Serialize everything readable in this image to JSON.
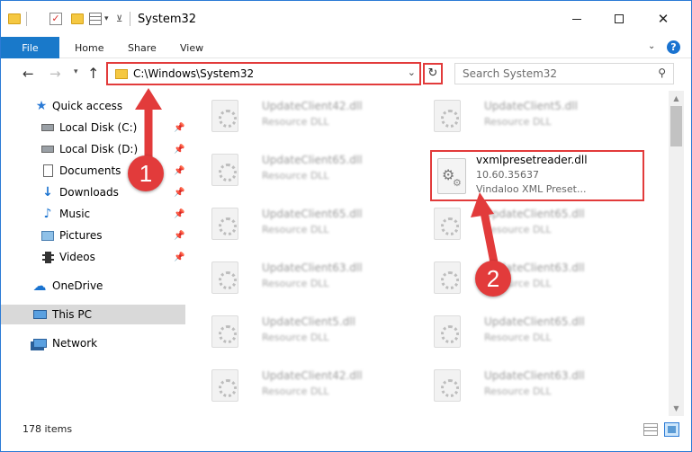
{
  "window": {
    "title": "System32"
  },
  "ribbon": {
    "file": "File",
    "tabs": [
      "Home",
      "Share",
      "View"
    ],
    "help": "?"
  },
  "address": {
    "path": "C:\\Windows\\System32",
    "search_placeholder": "Search System32"
  },
  "sidebar": {
    "items": [
      {
        "label": "Quick access",
        "icon": "star-icon",
        "pinned": false
      },
      {
        "label": "Local Disk (C:)",
        "icon": "drive-icon",
        "pinned": true
      },
      {
        "label": "Local Disk (D:)",
        "icon": "drive-icon",
        "pinned": true
      },
      {
        "label": "Documents",
        "icon": "documents-icon",
        "pinned": true
      },
      {
        "label": "Downloads",
        "icon": "download-icon",
        "pinned": true
      },
      {
        "label": "Music",
        "icon": "music-icon",
        "pinned": true
      },
      {
        "label": "Pictures",
        "icon": "pictures-icon",
        "pinned": true
      },
      {
        "label": "Videos",
        "icon": "videos-icon",
        "pinned": true
      },
      {
        "label": "OneDrive",
        "icon": "cloud-icon",
        "pinned": false
      },
      {
        "label": "This PC",
        "icon": "computer-icon",
        "pinned": false,
        "selected": true
      },
      {
        "label": "Network",
        "icon": "network-icon",
        "pinned": false
      }
    ]
  },
  "files": [
    {
      "name": "UpdateClient42.dll",
      "desc": "Resource DLL"
    },
    {
      "name": "UpdateClient5.dll",
      "desc": "Resource DLL"
    },
    {
      "name": "UpdateClient65.dll",
      "desc": "Resource DLL"
    },
    {
      "name": "UpdateClient65.dll",
      "desc": "Resource DLL"
    },
    {
      "name": "UpdateClient65.dll",
      "desc": "Resource DLL"
    },
    {
      "name": "UpdateClient63.dll",
      "desc": "Resource DLL"
    },
    {
      "name": "UpdateClient63.dll",
      "desc": "Resource DLL"
    },
    {
      "name": "UpdateClient5.dll",
      "desc": "Resource DLL"
    },
    {
      "name": "UpdateClient65.dll",
      "desc": "Resource DLL"
    },
    {
      "name": "UpdateClient42.dll",
      "desc": "Resource DLL"
    },
    {
      "name": "UpdateClient63.dll",
      "desc": "Resource DLL"
    }
  ],
  "highlighted_file": {
    "name": "vxmlpresetreader.dll",
    "version": "10.60.35637",
    "description": "Vindaloo XML Preset..."
  },
  "status": {
    "items": "178 items"
  },
  "annotations": {
    "step1": "1",
    "step2": "2",
    "color": "#e23b3b"
  }
}
